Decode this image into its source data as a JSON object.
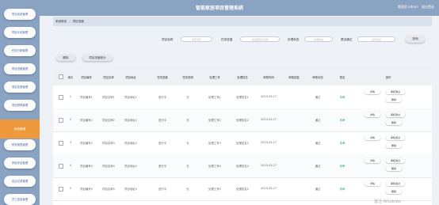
{
  "header": {
    "title": "智能家居项目管理系统",
    "user_label": "管理员 admin",
    "logout": "退出登录"
  },
  "sidebar": {
    "items": [
      {
        "label": "项目信息管理"
      },
      {
        "label": "项目计划管理"
      },
      {
        "label": "任务分配管理"
      },
      {
        "label": "项目进度管理"
      },
      {
        "label": "项目变更管理"
      },
      {
        "label": "项目预算管理"
      },
      {
        "label": "财务报表管理"
      },
      {
        "label": "风险评估管理"
      },
      {
        "label": "会议记录管理"
      },
      {
        "label": "员工信息管理"
      },
      {
        "label": "员工分配管理"
      }
    ],
    "active_label": "系统管理"
  },
  "breadcrumb": {
    "home": "系统首页",
    "current": "项目进度"
  },
  "search": {
    "fields": [
      {
        "label": "项目名称",
        "placeholder": "项目名称"
      },
      {
        "label": "任务进度",
        "placeholder": "请选择任务进度"
      },
      {
        "label": "处理状态",
        "placeholder": "处理状态"
      },
      {
        "label": "是否通过",
        "placeholder": "是否通过"
      }
    ],
    "button": "查询"
  },
  "actions": {
    "delete": "删除",
    "report": "项目进度统计"
  },
  "table": {
    "headers": [
      "索引",
      "项目编号",
      "项目名称",
      "项目地址",
      "任务进度",
      "任务说明",
      "处理工号",
      "处理姓名",
      "审核时间",
      "审核回复",
      "审核状态",
      "是否",
      "操作"
    ],
    "rows": [
      {
        "index": "1",
        "code": "项目编号1",
        "name": "项目名称1",
        "addr": "项目地址1",
        "progress": "进行中",
        "desc": "无",
        "worker_id": "处理工号1",
        "worker_name": "处理姓名1",
        "time": "2023-03-27",
        "reply": "",
        "audit": "通过",
        "status": "未审"
      },
      {
        "index": "2",
        "code": "项目编号2",
        "name": "项目名称2",
        "addr": "项目地址2",
        "progress": "进行中",
        "desc": "无",
        "worker_id": "处理工号2",
        "worker_name": "处理姓名2",
        "time": "2023-03-27",
        "reply": "",
        "audit": "通过",
        "status": "未审"
      },
      {
        "index": "3",
        "code": "项目编号3",
        "name": "项目名称3",
        "addr": "项目地址3",
        "progress": "进行中",
        "desc": "无",
        "worker_id": "处理工号3",
        "worker_name": "处理姓名3",
        "time": "2023-03-27",
        "reply": "",
        "audit": "通过",
        "status": "未审"
      },
      {
        "index": "4",
        "code": "项目编号4",
        "name": "项目名称4",
        "addr": "项目地址4",
        "progress": "进行中",
        "desc": "无",
        "worker_id": "处理工号4",
        "worker_name": "处理姓名4",
        "time": "2023-03-27",
        "reply": "",
        "audit": "通过",
        "status": "未审"
      },
      {
        "index": "5",
        "code": "项目编号5",
        "name": "项目名称5",
        "addr": "项目地址5",
        "progress": "进行中",
        "desc": "无",
        "worker_id": "处理工号5",
        "worker_name": "处理姓名5",
        "time": "2023-03-27",
        "reply": "",
        "audit": "通过",
        "status": "未审"
      }
    ],
    "op": {
      "detail": "详情",
      "audit": "审核通过",
      "delete": "删除"
    }
  },
  "watermark": "激活 Windows"
}
